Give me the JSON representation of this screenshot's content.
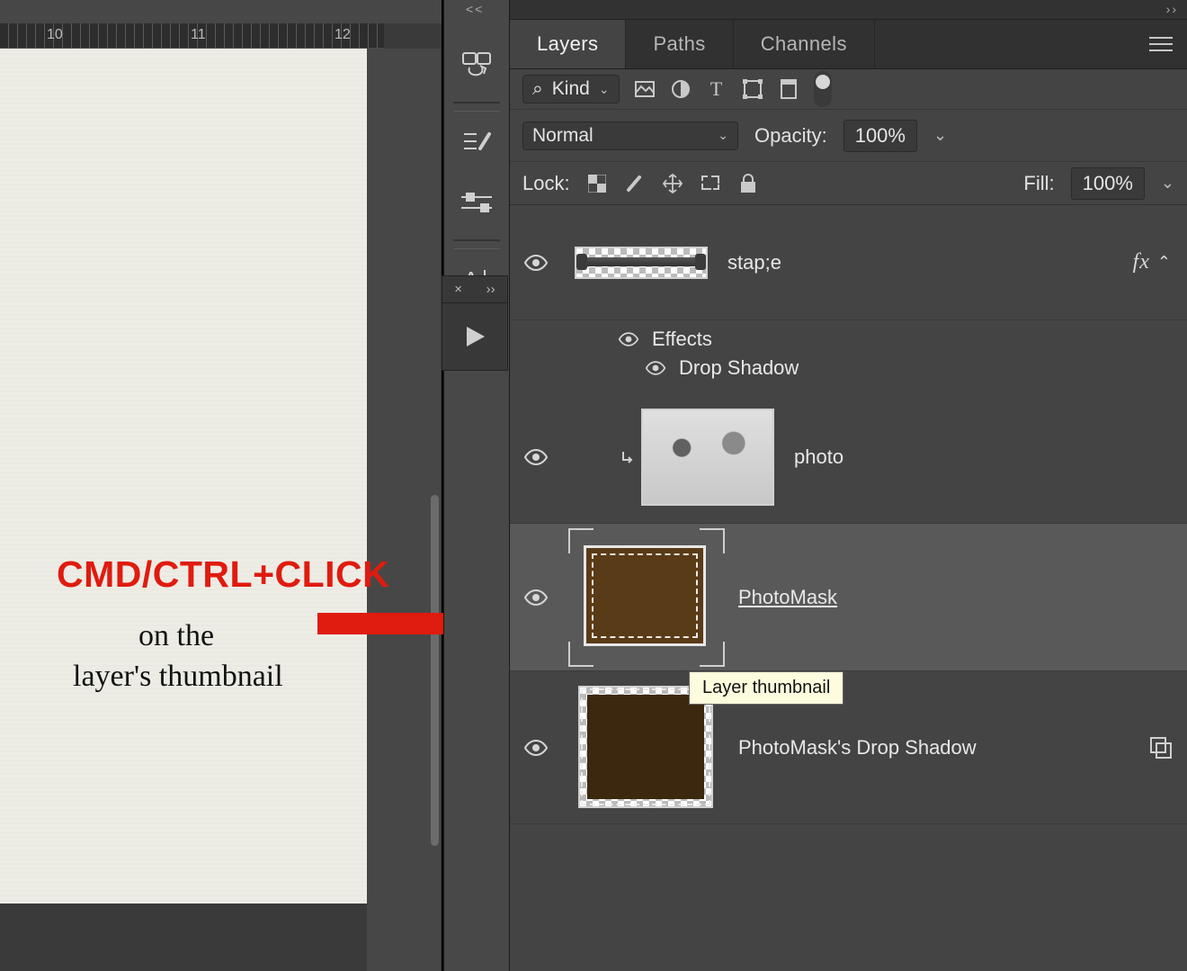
{
  "annotation": {
    "title": "CMD/CTRL+CLICK",
    "line1": "on the",
    "line2": "layer's thumbnail"
  },
  "ruler": {
    "marks": [
      "10",
      "11",
      "12"
    ]
  },
  "tabs": {
    "layers": "Layers",
    "paths": "Paths",
    "channels": "Channels",
    "active": "layers"
  },
  "filter": {
    "kind_label": "Kind",
    "search_glyph": "⌕"
  },
  "blend": {
    "mode": "Normal",
    "opacity_label": "Opacity:",
    "opacity_value": "100%"
  },
  "lock": {
    "label": "Lock:",
    "fill_label": "Fill:",
    "fill_value": "100%"
  },
  "fx_label": "fx",
  "layers": [
    {
      "name": "stap;e",
      "has_fx": true
    },
    {
      "effects_title": "Effects",
      "effect_item": "Drop Shadow"
    },
    {
      "name": "photo",
      "clipped": true
    },
    {
      "name": "PhotoMask",
      "selected": true,
      "underline": true
    },
    {
      "name": "PhotoMask's Drop Shadow",
      "smart": true
    }
  ],
  "tooltip": "Layer thumbnail"
}
